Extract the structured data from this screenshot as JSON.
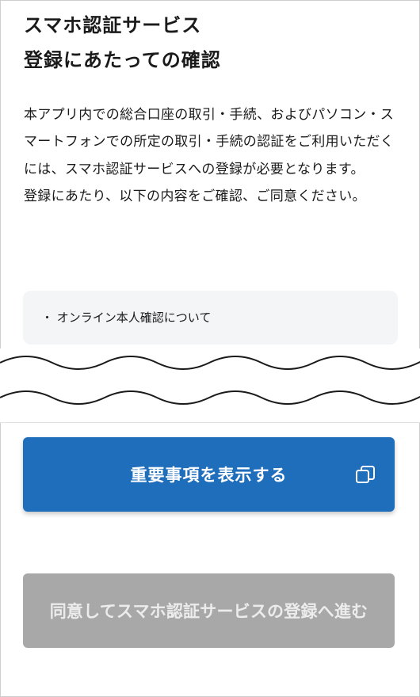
{
  "header": {
    "title_line1": "スマホ認証サービス",
    "title_line2": "登録にあたっての確認"
  },
  "content": {
    "paragraph1": "本アプリ内での総合口座の取引・手続、およびパソコン・スマートフォンでの所定の取引・手続の認証をご利用いただくには、スマホ認証サービスへの登録が必要となります。",
    "paragraph2": "登録にあたり、以下の内容をご確認、ご同意ください。"
  },
  "notice": {
    "items": [
      "・ オンライン本人確認について"
    ]
  },
  "actions": {
    "show_important_label": "重要事項を表示する",
    "show_important_icon": "external-window-icon",
    "agree_label": "同意してスマホ認証サービスの登録へ進む",
    "agree_enabled": false
  },
  "colors": {
    "primary": "#1f6ebc",
    "disabled": "#a8a8a8",
    "notice_bg": "#f4f5f7"
  }
}
